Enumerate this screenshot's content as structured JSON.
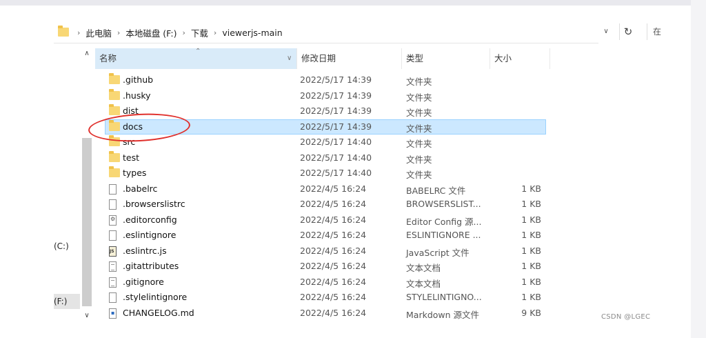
{
  "address_bar": {
    "breadcrumbs": [
      "此电脑",
      "本地磁盘 (F:)",
      "下载",
      "viewerjs-main"
    ],
    "search_partial": "在"
  },
  "nav": {
    "drive_c": "(C:)",
    "drive_f": "(F:)"
  },
  "columns": {
    "name": "名称",
    "date": "修改日期",
    "type": "类型",
    "size": "大小"
  },
  "files": [
    {
      "name": ".github",
      "date": "2022/5/17 14:39",
      "type": "文件夹",
      "size": "",
      "icon": "folder-icon"
    },
    {
      "name": ".husky",
      "date": "2022/5/17 14:39",
      "type": "文件夹",
      "size": "",
      "icon": "folder-icon"
    },
    {
      "name": "dist",
      "date": "2022/5/17 14:39",
      "type": "文件夹",
      "size": "",
      "icon": "folder-icon"
    },
    {
      "name": "docs",
      "date": "2022/5/17 14:39",
      "type": "文件夹",
      "size": "",
      "icon": "folder-icon",
      "selected": true
    },
    {
      "name": "src",
      "date": "2022/5/17 14:40",
      "type": "文件夹",
      "size": "",
      "icon": "folder-icon"
    },
    {
      "name": "test",
      "date": "2022/5/17 14:40",
      "type": "文件夹",
      "size": "",
      "icon": "folder-icon"
    },
    {
      "name": "types",
      "date": "2022/5/17 14:40",
      "type": "文件夹",
      "size": "",
      "icon": "folder-icon"
    },
    {
      "name": ".babelrc",
      "date": "2022/4/5 16:24",
      "type": "BABELRC 文件",
      "size": "1 KB",
      "icon": "file-icon"
    },
    {
      "name": ".browserslistrc",
      "date": "2022/4/5 16:24",
      "type": "BROWSERSLIST...",
      "size": "1 KB",
      "icon": "file-icon"
    },
    {
      "name": ".editorconfig",
      "date": "2022/4/5 16:24",
      "type": "Editor Config 源...",
      "size": "1 KB",
      "icon": "config-file-icon"
    },
    {
      "name": ".eslintignore",
      "date": "2022/4/5 16:24",
      "type": "ESLINTIGNORE ...",
      "size": "1 KB",
      "icon": "file-icon"
    },
    {
      "name": ".eslintrc.js",
      "date": "2022/4/5 16:24",
      "type": "JavaScript 文件",
      "size": "1 KB",
      "icon": "javascript-file-icon"
    },
    {
      "name": ".gitattributes",
      "date": "2022/4/5 16:24",
      "type": "文本文档",
      "size": "1 KB",
      "icon": "text-file-icon"
    },
    {
      "name": ".gitignore",
      "date": "2022/4/5 16:24",
      "type": "文本文档",
      "size": "1 KB",
      "icon": "text-file-icon"
    },
    {
      "name": ".stylelintignore",
      "date": "2022/4/5 16:24",
      "type": "STYLELINTIGNO...",
      "size": "1 KB",
      "icon": "file-icon"
    },
    {
      "name": "CHANGELOG.md",
      "date": "2022/4/5 16:24",
      "type": "Markdown 源文件",
      "size": "9 KB",
      "icon": "markdown-file-icon"
    }
  ],
  "watermark": "CSDN @LGEC",
  "colors": {
    "selection_bg": "#cce8ff",
    "selection_border": "#99d1ff",
    "annotation": "#e0302c",
    "folder": "#f8d775"
  }
}
